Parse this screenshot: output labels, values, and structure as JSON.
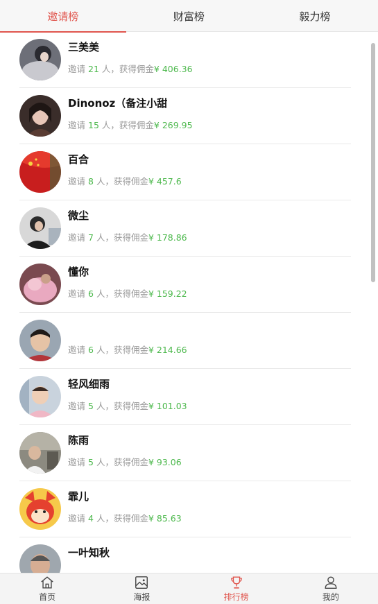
{
  "tabs": [
    {
      "label": "邀请榜",
      "active": true
    },
    {
      "label": "财富榜",
      "active": false
    },
    {
      "label": "毅力榜",
      "active": false
    }
  ],
  "stat_template": {
    "prefix": "邀请",
    "people_suffix": "人，获得佣金",
    "currency": "¥"
  },
  "ranking": [
    {
      "name": "三美美",
      "invites": "21",
      "commission": "406.36",
      "avatar_icon": "user-photo-avatar"
    },
    {
      "name": "Dinonoz（备注小甜",
      "invites": "15",
      "commission": "269.95",
      "avatar_icon": "user-photo-avatar"
    },
    {
      "name": "百合",
      "invites": "8",
      "commission": "457.6",
      "avatar_icon": "user-photo-avatar"
    },
    {
      "name": "微尘",
      "invites": "7",
      "commission": "178.86",
      "avatar_icon": "user-photo-avatar"
    },
    {
      "name": "懂你",
      "invites": "6",
      "commission": "159.22",
      "avatar_icon": "user-photo-avatar"
    },
    {
      "name": "",
      "invites": "6",
      "commission": "214.66",
      "avatar_icon": "user-photo-avatar"
    },
    {
      "name": "轻风细雨",
      "invites": "5",
      "commission": "101.03",
      "avatar_icon": "user-photo-avatar"
    },
    {
      "name": "陈雨",
      "invites": "5",
      "commission": "93.06",
      "avatar_icon": "user-photo-avatar"
    },
    {
      "name": "霏儿",
      "invites": "4",
      "commission": "85.63",
      "avatar_icon": "user-photo-avatar"
    },
    {
      "name": "一叶知秋",
      "invites": "",
      "commission": "",
      "avatar_icon": "user-photo-avatar"
    }
  ],
  "bottom_nav": [
    {
      "label": "首页",
      "icon": "home-icon",
      "active": false
    },
    {
      "label": "海报",
      "icon": "poster-icon",
      "active": false
    },
    {
      "label": "排行榜",
      "icon": "trophy-icon",
      "active": true
    },
    {
      "label": "我的",
      "icon": "person-icon",
      "active": false
    }
  ],
  "colors": {
    "accent": "#e0554d",
    "stat_value": "#4cb84c",
    "muted_text": "#999999"
  }
}
